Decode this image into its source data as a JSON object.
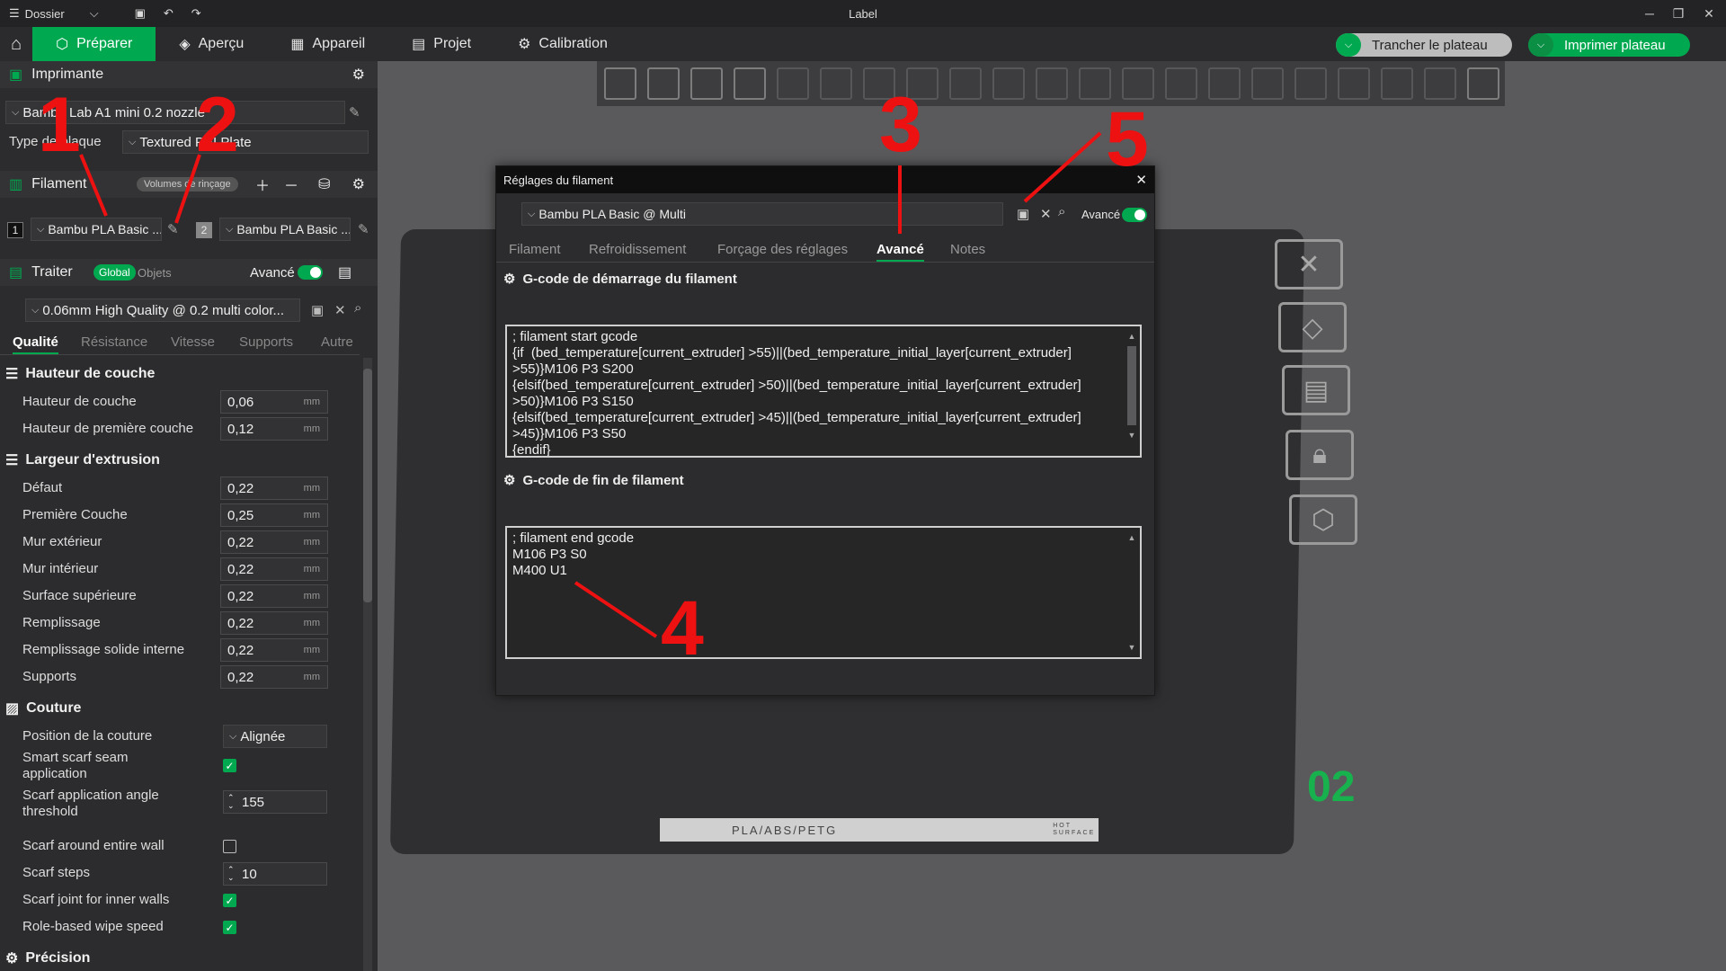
{
  "window": {
    "title": "Label",
    "menu_label": "Dossier"
  },
  "tabs": [
    "Préparer",
    "Aperçu",
    "Appareil",
    "Projet",
    "Calibration"
  ],
  "actions": {
    "slice": "Trancher le plateau",
    "print": "Imprimer plateau"
  },
  "printer": {
    "header": "Imprimante",
    "name": "Bambu Lab A1 mini 0.2 nozzle",
    "plate_label": "Type de plaque",
    "plate_value": "Textured PEI Plate"
  },
  "filament": {
    "header": "Filament",
    "flush_label": "Volumes de rinçage",
    "slots": [
      {
        "num": "1",
        "name": "Bambu PLA Basic ..."
      },
      {
        "num": "2",
        "name": "Bambu PLA Basic ..."
      }
    ]
  },
  "process": {
    "header": "Traiter",
    "global": "Global",
    "objects": "Objets",
    "advanced": "Avancé",
    "preset": "0.06mm High Quality @ 0.2 multi color...",
    "tabs": [
      "Qualité",
      "Résistance",
      "Vitesse",
      "Supports",
      "Autre"
    ]
  },
  "quality": {
    "layer_group": "Hauteur de couche",
    "layer_rows": [
      {
        "label": "Hauteur de couche",
        "value": "0,06",
        "unit": "mm"
      },
      {
        "label": "Hauteur de première couche",
        "value": "0,12",
        "unit": "mm"
      }
    ],
    "width_group": "Largeur d'extrusion",
    "width_rows": [
      {
        "label": "Défaut",
        "value": "0,22",
        "unit": "mm"
      },
      {
        "label": "Première Couche",
        "value": "0,25",
        "unit": "mm"
      },
      {
        "label": "Mur extérieur",
        "value": "0,22",
        "unit": "mm"
      },
      {
        "label": "Mur intérieur",
        "value": "0,22",
        "unit": "mm"
      },
      {
        "label": "Surface supérieure",
        "value": "0,22",
        "unit": "mm"
      },
      {
        "label": "Remplissage",
        "value": "0,22",
        "unit": "mm"
      },
      {
        "label": "Remplissage solide interne",
        "value": "0,22",
        "unit": "mm"
      },
      {
        "label": "Supports",
        "value": "0,22",
        "unit": "mm"
      }
    ],
    "seam_group": "Couture",
    "seam_position_label": "Position de la couture",
    "seam_position_value": "Alignée",
    "smart_scarf": "Smart scarf seam\napplication",
    "scarf_angle_label": "Scarf application angle\nthreshold",
    "scarf_angle_value": "155",
    "scarf_entire": "Scarf around entire wall",
    "scarf_steps_label": "Scarf steps",
    "scarf_steps_value": "10",
    "scarf_inner": "Scarf joint for inner walls",
    "wipe_speed": "Role-based wipe speed",
    "precision_group": "Précision"
  },
  "dialog": {
    "title": "Réglages du filament",
    "preset": "Bambu PLA Basic @ Multi",
    "advanced": "Avancé",
    "tabs": [
      "Filament",
      "Refroidissement",
      "Forçage des réglages",
      "Avancé",
      "Notes"
    ],
    "start_header": "G-code de démarrage du filament",
    "start_code": "; filament start gcode\n{if  (bed_temperature[current_extruder] >55)||(bed_temperature_initial_layer[current_extruder]\n>55)}M106 P3 S200\n{elsif(bed_temperature[current_extruder] >50)||(bed_temperature_initial_layer[current_extruder]\n>50)}M106 P3 S150\n{elsif(bed_temperature[current_extruder] >45)||(bed_temperature_initial_layer[current_extruder]\n>45)}M106 P3 S50\n{endif}",
    "end_header": "G-code de fin de filament",
    "end_code": "; filament end gcode\nM106 P3 S0\nM400 U1"
  },
  "plate": {
    "id": "02",
    "strip_text": "PLA/ABS/PETG",
    "hot_label": "HOT\nSURFACE"
  },
  "annotations": [
    "1",
    "2",
    "3",
    "4",
    "5"
  ],
  "colors": {
    "accent": "#00a84f",
    "annotation": "#ee1111"
  }
}
